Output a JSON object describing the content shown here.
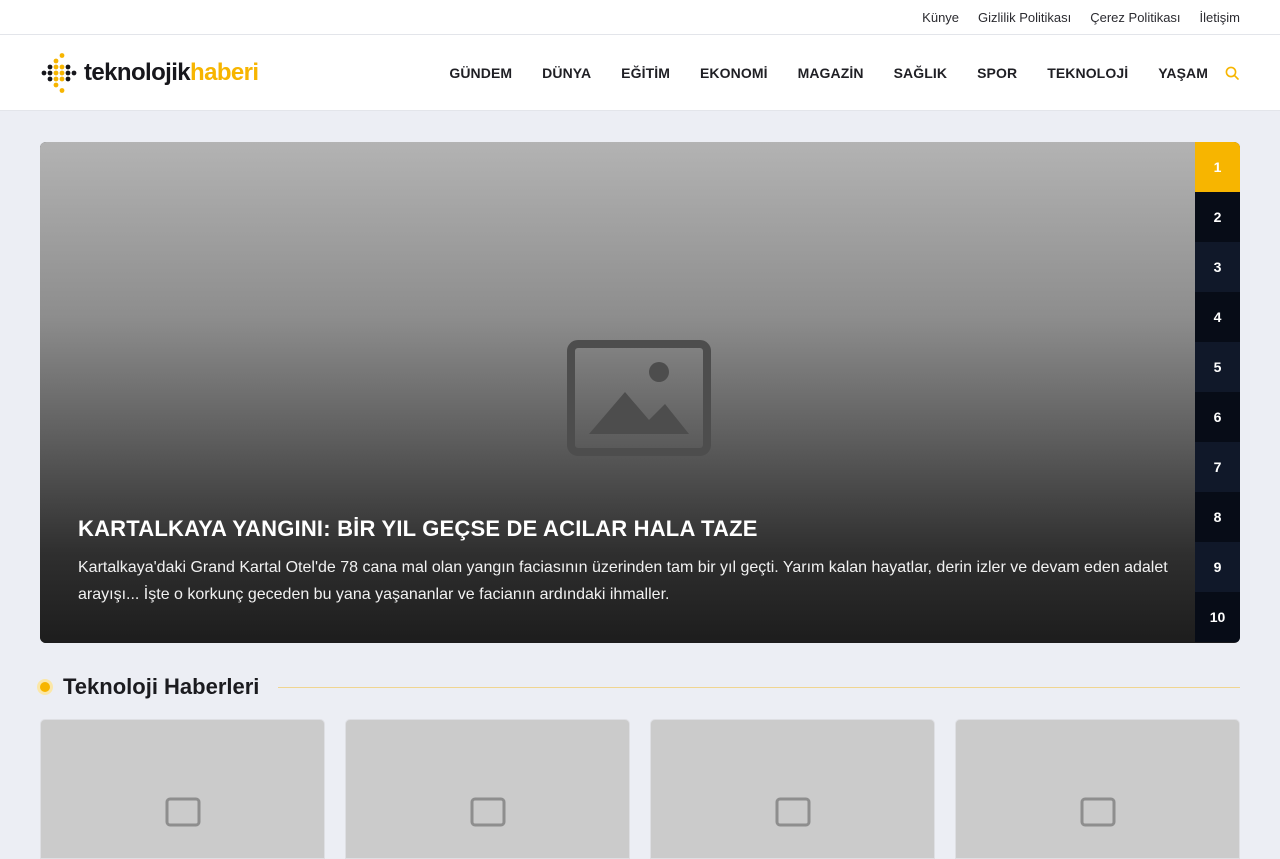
{
  "topbar": {
    "links": [
      "Künye",
      "Gizlilik Politikası",
      "Çerez Politikası",
      "İletişim"
    ]
  },
  "logo": {
    "part1": "teknolojik",
    "part2": "haberi"
  },
  "nav": {
    "items": [
      "GÜNDEM",
      "DÜNYA",
      "EĞİTİM",
      "EKONOMİ",
      "MAGAZİN",
      "SAĞLIK",
      "SPOR",
      "TEKNOLOJİ",
      "YAŞAM"
    ],
    "search_icon": "search-icon"
  },
  "slider": {
    "title": "KARTALKAYA YANGINI: BİR YIL GEÇSE DE ACILAR HALA TAZE",
    "description": "Kartalkaya'daki Grand Kartal Otel'de 78 cana mal olan yangın faciasının üzerinden tam bir yıl geçti. Yarım kalan hayatlar, derin izler ve devam eden adalet arayışı... İşte o korkunç geceden bu yana yaşananlar ve facianın ardındaki ihmaller.",
    "numbers": [
      "1",
      "2",
      "3",
      "4",
      "5",
      "6",
      "7",
      "8",
      "9",
      "10"
    ],
    "active": "1",
    "image_icon": "image-placeholder-icon"
  },
  "section": {
    "title": "Teknoloji Haberleri"
  },
  "colors": {
    "accent": "#f7b500",
    "nav_dark": "#070c17",
    "nav_alt": "#101829"
  }
}
